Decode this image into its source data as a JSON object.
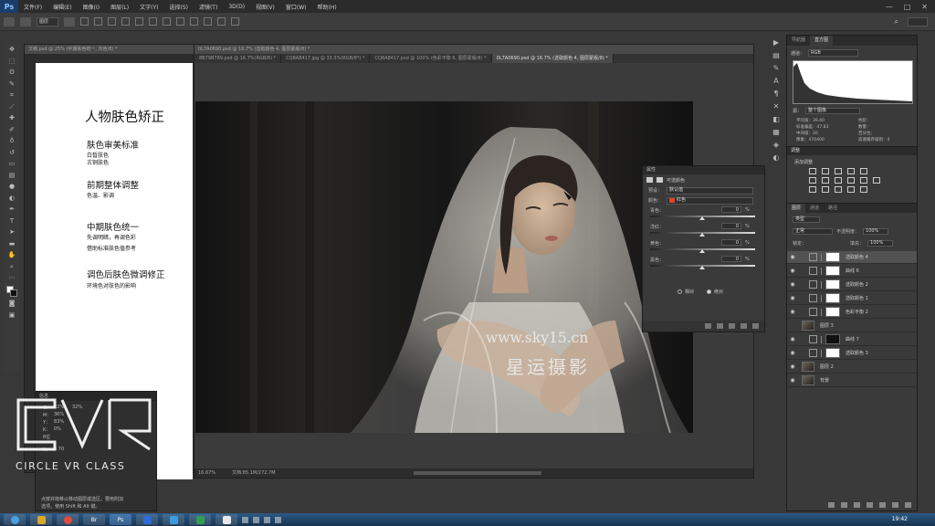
{
  "app": {
    "logo": "Ps",
    "menus": [
      "文件(F)",
      "编辑(E)",
      "图像(I)",
      "图层(L)",
      "文字(Y)",
      "选择(S)",
      "滤镜(T)",
      "3D(D)",
      "视图(V)",
      "窗口(W)",
      "帮助(H)"
    ],
    "window_controls": [
      "—",
      "□",
      "✕"
    ]
  },
  "options_bar": {
    "mode_select": "图层"
  },
  "doc1": {
    "title": "文稿.psd @ 25% (中期肤色统一, 灰色/8) *",
    "canvas": {
      "title": "人物肤色矫正",
      "sections": [
        {
          "heading": "肤色审美标准",
          "lines": [
            "白皙肤色",
            "古铜肤色"
          ]
        },
        {
          "heading": "前期整体调整",
          "lines": [
            "色温、影调"
          ]
        },
        {
          "heading": "中期肤色统一",
          "lines": [
            "先调明暗，再调色彩",
            "借助标准肤色值参考"
          ]
        },
        {
          "heading": "调色后肤色微调修正",
          "lines": [
            "环境色对肤色的影响"
          ]
        }
      ]
    }
  },
  "doc2": {
    "title": "0L7A0690.psd @ 16.7% (选取颜色 4, 图层蒙版/8) *",
    "tabs": [
      {
        "label": "8B79B789.psd @ 16.7%(RGB/8) *",
        "active": false
      },
      {
        "label": "CQ8A8417.jpg @ 33.3%(RGB/8*) *",
        "active": false
      },
      {
        "label": "CQ8A8417.psd @ 100% (色彩平衡 6, 图层蒙版/8) *",
        "active": false
      },
      {
        "label": "0L7A0690.psd @ 16.7% (选取颜色 4, 图层蒙版/8) *",
        "active": true
      }
    ],
    "zoom": "16.67%",
    "doc_size": "文档:85.1M/272.7M",
    "watermark_url": "www.sky15.cn",
    "watermark_script": "星运摄影"
  },
  "properties": {
    "title": "属性",
    "panel_name": "可选颜色",
    "preset_label": "预设：",
    "preset_value": "默认值",
    "color_label": "颜色：",
    "color_value": "红色",
    "color_chip": "#e0451f",
    "sliders": [
      {
        "label": "青色：",
        "value": "0",
        "unit": "%"
      },
      {
        "label": "洋红：",
        "value": "0",
        "unit": "%"
      },
      {
        "label": "黄色：",
        "value": "0",
        "unit": "%"
      },
      {
        "label": "黑色：",
        "value": "0",
        "unit": "%"
      }
    ],
    "radio_relative": "相对",
    "radio_absolute": "绝对"
  },
  "info": {
    "title": "信息",
    "rows": [
      {
        "a": "C：",
        "b": "32%",
        "c": "32%",
        "d": "M：",
        "e": "36%"
      },
      {
        "a": "Y：",
        "b": "83%",
        "c": "",
        "d": "K：",
        "e": "0%"
      },
      {
        "a": "8位",
        "b": "",
        "c": "",
        "d": "",
        "e": ""
      }
    ],
    "x_label": "X：",
    "x_val": "9.70",
    "hint_1": "点按并拖移以移动图层或选区。要用附加",
    "hint_2": "选项，使用 Shift 和 Alt 键。"
  },
  "cvr": {
    "brand": "CIRCLE VR CLASS"
  },
  "histogram": {
    "tabs": [
      "导航器",
      "直方图"
    ],
    "channel_label": "通道：",
    "channel_value": "RGB",
    "source_label": "源：",
    "source_value": "整个图像",
    "stats_left": [
      "平均值：39.40",
      "标准偏差：47.83",
      "中间值：20",
      "像素：470400"
    ],
    "stats_right": [
      "色阶：",
      "数量：",
      "百分位：",
      "高速缓存级别：4"
    ]
  },
  "adjustments": {
    "title": "调整",
    "subtitle": "添加调整"
  },
  "layers": {
    "tabs": [
      "图层",
      "通道",
      "路径"
    ],
    "kind_label": "类型",
    "blend_mode": "正常",
    "opacity_label": "不透明度：",
    "opacity_value": "100%",
    "lock_label": "锁定：",
    "fill_label": "填充：",
    "fill_value": "100%",
    "items": [
      {
        "name": "选取颜色 4",
        "type": "adj",
        "visible": true,
        "selected": true
      },
      {
        "name": "曲线 6",
        "type": "adj",
        "visible": true,
        "selected": false
      },
      {
        "name": "选取颜色 2",
        "type": "adj",
        "visible": true,
        "selected": false
      },
      {
        "name": "选取颜色 1",
        "type": "adj",
        "visible": true,
        "selected": false
      },
      {
        "name": "色彩平衡 2",
        "type": "adj",
        "visible": true,
        "selected": false
      },
      {
        "name": "图层 3",
        "type": "photo",
        "visible": false,
        "selected": false
      },
      {
        "name": "曲线 7",
        "type": "adj-dark",
        "visible": true,
        "selected": false
      },
      {
        "name": "选取颜色 3",
        "type": "adj",
        "visible": true,
        "selected": false
      },
      {
        "name": "图层 2",
        "type": "photo",
        "visible": true,
        "selected": false
      },
      {
        "name": "背景",
        "type": "photo",
        "visible": true,
        "selected": false
      }
    ]
  },
  "taskbar": {
    "apps": [
      "",
      "",
      "",
      "Br",
      "Ps",
      "",
      "",
      "",
      "",
      ""
    ],
    "clock_time": "19:42"
  }
}
